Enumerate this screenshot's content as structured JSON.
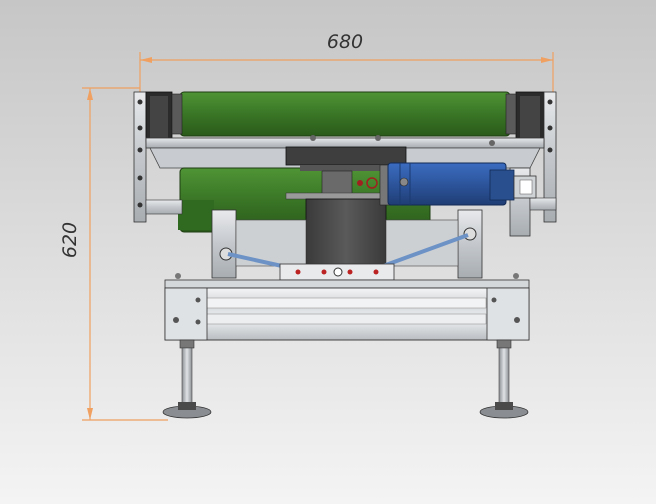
{
  "dimensions": {
    "width": {
      "label": "680",
      "value": 680
    },
    "height": {
      "label": "620",
      "value": 620
    }
  },
  "colors": {
    "background_top": "#c9c9c9",
    "background_bottom": "#f2f2f2",
    "dimension_line": "#f5a05a",
    "belt_green": "#3f7f2a",
    "motor_blue": "#2f5aa8",
    "frame_steel": "#b8bcc0",
    "dark_steel": "#4a4a4a",
    "rod_blue": "#7fa6d6"
  },
  "parts": [
    "conveyor-belt-roller",
    "drive-motor",
    "turntable-column",
    "aluminum-profile-base",
    "leveling-feet",
    "tie-rods"
  ]
}
